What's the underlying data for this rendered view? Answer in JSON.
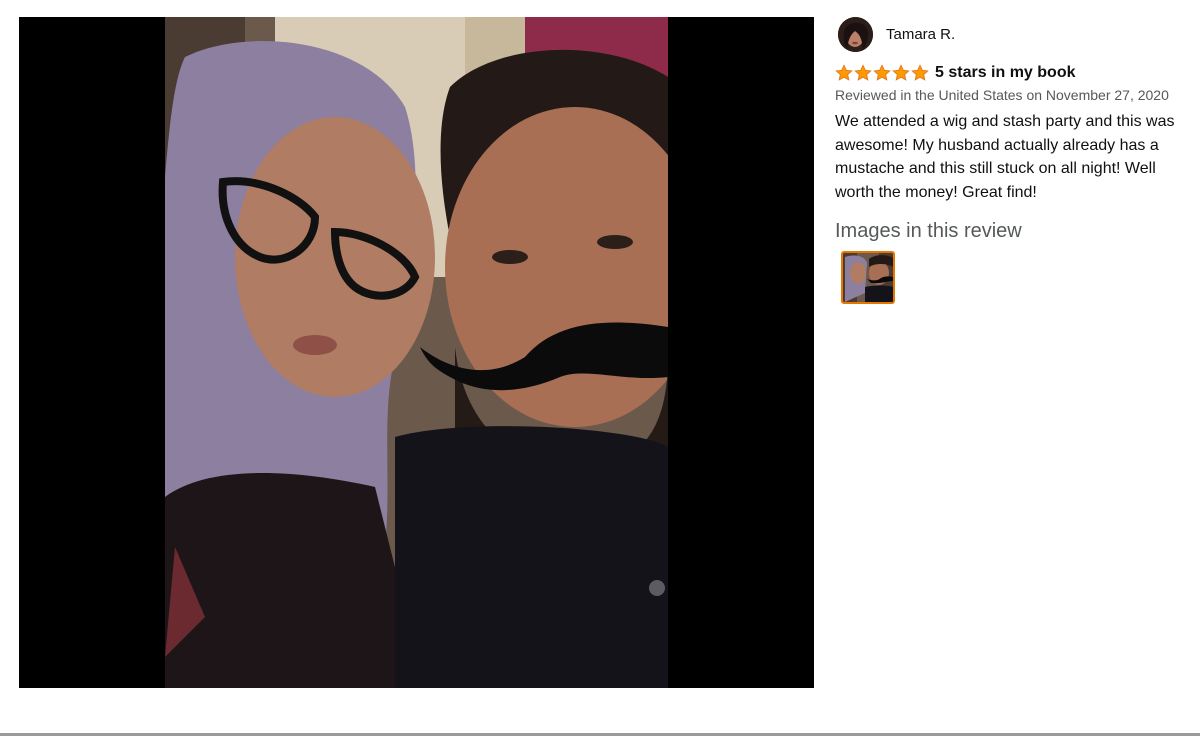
{
  "review": {
    "reviewer_name": "Tamara R.",
    "rating": 5,
    "rating_max": 5,
    "title": "5 stars in my book",
    "date_line": "Reviewed in the United States on November 27, 2020",
    "body": "We attended a wig and stash party and this was awesome! My husband actually already has a mustache and this still stuck on all night! Well worth the money! Great find!",
    "images_heading": "Images in this review",
    "thumbnail_count": 1
  },
  "colors": {
    "star": "#ff9900",
    "thumb_border": "#e77600",
    "muted_text": "#565959"
  },
  "icons": {
    "star": "star-icon",
    "avatar": "reviewer-avatar"
  }
}
